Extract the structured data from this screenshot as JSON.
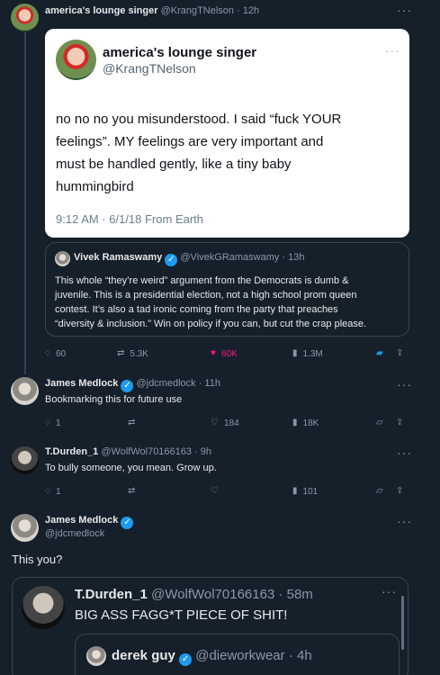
{
  "top": {
    "name": "america's lounge singer",
    "meta": "@KrangTNelson · 12h"
  },
  "screenshot_card": {
    "name": "america's lounge singer",
    "handle": "@KrangTNelson",
    "text_lines": [
      "no no no you misunderstood. I said “fuck YOUR",
      "feelings”. MY feelings are very important and",
      "must be handled gently, like a tiny baby",
      "hummingbird"
    ],
    "timestamp": "9:12 AM · 6/1/18 From Earth"
  },
  "quoted": {
    "name": "Vivek Ramaswamy",
    "meta": "@VivekGRamaswamy · 13h",
    "text_lines": [
      "This whole “they’re weird” argument from the Democrats is dumb &",
      "juvenile. This is a presidential election, not a high school prom queen",
      "contest. It’s also a tad ironic coming from the party that preaches",
      "“diversity & inclusion.” Win on policy if you can, but cut the crap please."
    ]
  },
  "top_actions": {
    "replies": "60",
    "reposts": "5.3K",
    "likes": "60K",
    "views": "1.3M"
  },
  "replies": [
    {
      "name": "James Medlock",
      "meta": "@jdcmedlock · 11h",
      "text": "Bookmarking this for future use",
      "replies": "1",
      "likes": "184",
      "views": "18K"
    },
    {
      "name": "T.Durden_1",
      "meta": "@WolfWol70166163 · 9h",
      "text": "To bully someone, you mean. Grow up.",
      "replies": "1",
      "likes": "",
      "views": "101"
    }
  ],
  "post": {
    "name": "James Medlock",
    "handle": "@jdcmedlock",
    "text": "This you?"
  },
  "nested_quote": {
    "name": "T.Durden_1",
    "meta": "@WolfWol70166163 · 58m",
    "text": "BIG ASS FAGG*T PIECE OF SHIT!",
    "inner_name": "derek guy",
    "inner_meta": "@dieworkwear · 4h"
  },
  "colors": {
    "background": "#16202b",
    "accent": "#1d9bf0",
    "liked": "#f91880"
  },
  "icons": {
    "reply": "speech-bubble",
    "repost": "repost-arrows",
    "like": "heart",
    "views": "bar-chart",
    "bookmark": "bookmark",
    "share": "share-arrow",
    "more": "dots"
  }
}
